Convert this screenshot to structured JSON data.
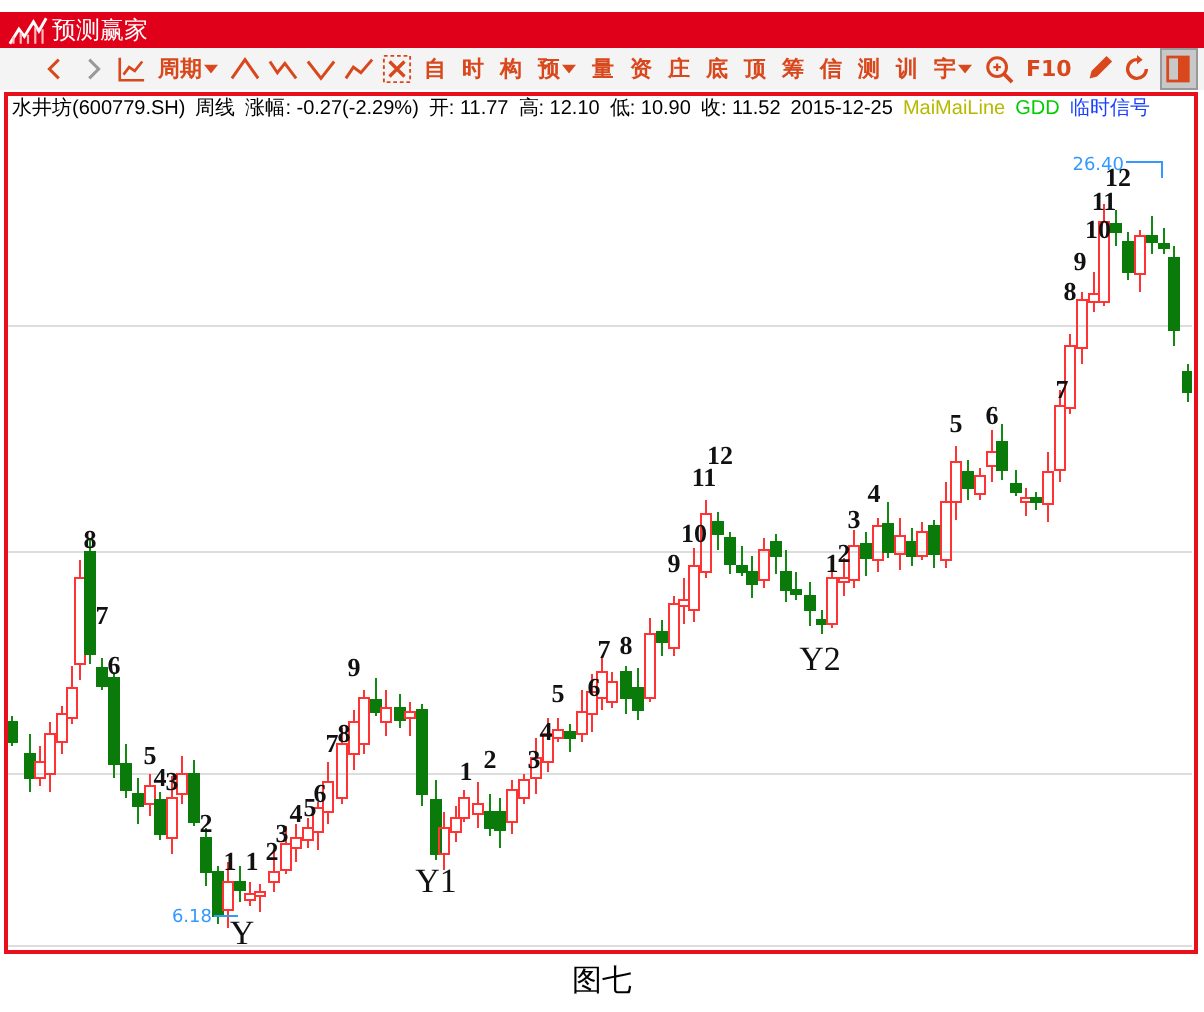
{
  "window": {
    "title": "预测赢家"
  },
  "toolbar": {
    "period_button": {
      "label": "周期",
      "dropdown": true
    },
    "tools": [
      {
        "label": "自",
        "dropdown": false
      },
      {
        "label": "时",
        "dropdown": false
      },
      {
        "label": "构",
        "dropdown": false
      },
      {
        "label": "预",
        "dropdown": true
      },
      {
        "label": "量",
        "dropdown": false
      },
      {
        "label": "资",
        "dropdown": false
      },
      {
        "label": "庄",
        "dropdown": false
      },
      {
        "label": "底",
        "dropdown": false
      },
      {
        "label": "顶",
        "dropdown": false
      },
      {
        "label": "筹",
        "dropdown": false
      },
      {
        "label": "信",
        "dropdown": false
      },
      {
        "label": "测",
        "dropdown": false
      },
      {
        "label": "训",
        "dropdown": false
      },
      {
        "label": "宇",
        "dropdown": true
      }
    ],
    "f10_button": {
      "label": "F10"
    },
    "panel_toggle": {
      "selected": true
    }
  },
  "info_bar": {
    "fields": [
      "水井坊(600779.SH)",
      "周线",
      "涨幅: -0.27(-2.29%)",
      "开: 11.77",
      "高: 12.10",
      "低: 10.90",
      "收: 11.52",
      "2015-12-25"
    ],
    "legend": [
      {
        "text": "MaiMaiLine",
        "color": "#b8b800"
      },
      {
        "text": "GDD",
        "color": "#00cc00"
      },
      {
        "text": "临时信号",
        "color": "#1a40ff"
      }
    ]
  },
  "chart": {
    "wave_labels": [
      "8",
      "7",
      "6",
      "5",
      "4",
      "3",
      "2",
      "1",
      "1",
      "2",
      "3",
      "4",
      "5",
      "6",
      "7",
      "8",
      "9",
      "1",
      "2",
      "3",
      "4",
      "5",
      "6",
      "7",
      "8",
      "9",
      "10",
      "11",
      "12",
      "1",
      "2",
      "3",
      "4",
      "5",
      "6",
      "7",
      "8",
      "9",
      "10",
      "11",
      "12"
    ],
    "point_labels": [
      "Y",
      "Y1",
      "Y2"
    ],
    "price_marks": [
      "6.18",
      "26.40"
    ]
  },
  "caption": "图七"
}
